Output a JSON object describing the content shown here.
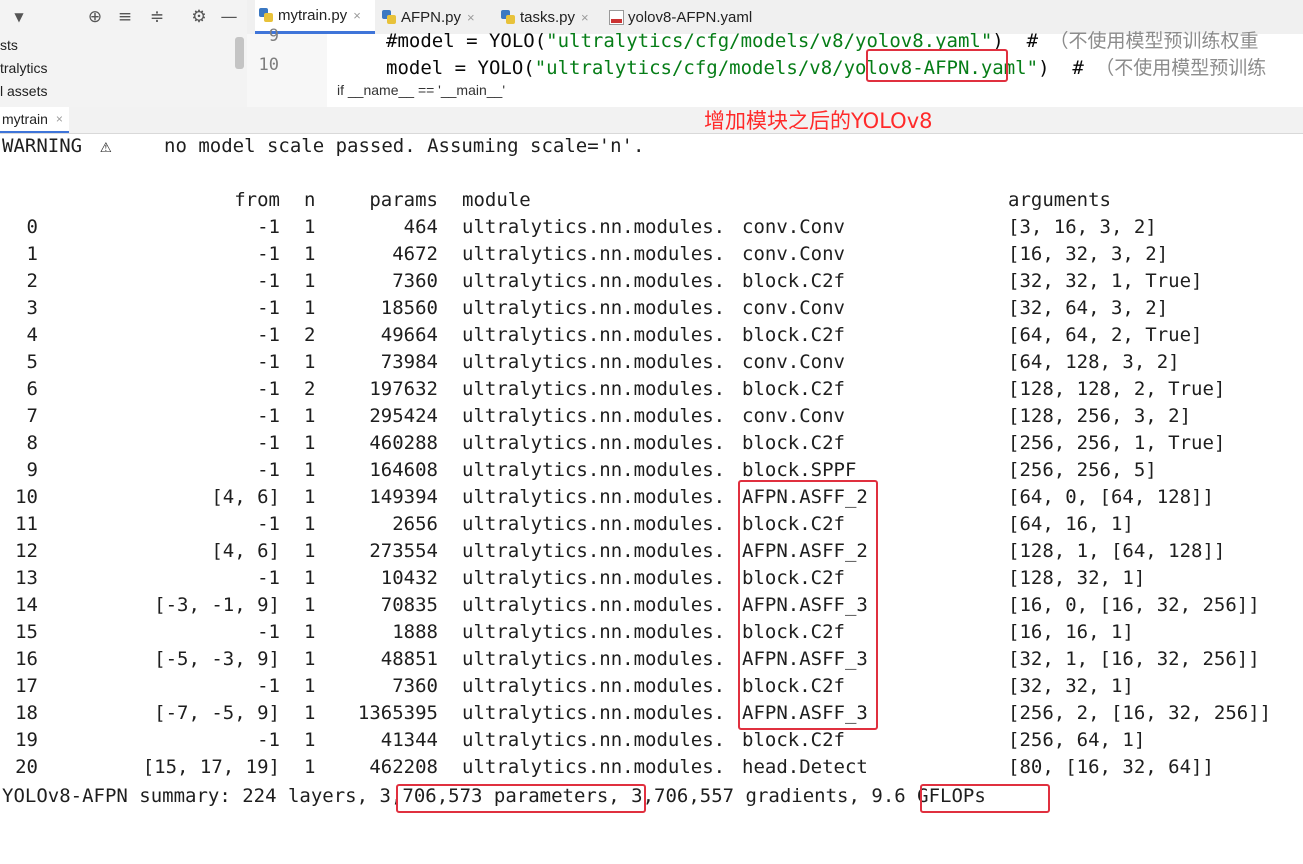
{
  "project_panel": {
    "tree_items": [
      "sts",
      "tralytics",
      "l assets"
    ]
  },
  "editor_tabs": [
    {
      "label": "mytrain.py",
      "icon": "python-file-icon",
      "active": true
    },
    {
      "label": "AFPN.py",
      "icon": "python-file-icon",
      "active": false
    },
    {
      "label": "tasks.py",
      "icon": "python-file-icon",
      "active": false
    },
    {
      "label": "yolov8-AFPN.yaml",
      "icon": "yaml-file-icon",
      "active": false
    }
  ],
  "editor": {
    "lines": [
      {
        "number": "9",
        "code_prefix": "#model = YOLO(",
        "code_string": "\"ultralytics/cfg/models/v8/yolov8.yaml\"",
        "code_rest": ")  # ",
        "comment": "（不使用模型预训练权重"
      },
      {
        "number": "10",
        "code_prefix": "model = YOLO(",
        "code_string_a": "\"ultralytics/cfg/models/v8/",
        "code_string_b": "yolov8-AFPN",
        "code_string_c": ".yaml\"",
        "code_rest": ")  # ",
        "comment": "（不使用模型预训练"
      }
    ],
    "breadcrumb": "if __name__ == '__main__'"
  },
  "run_tab": {
    "label": "mytrain"
  },
  "annotation_text": "增加模块之后的YOLOv8",
  "console": {
    "warning_prefix": "WARNING",
    "warning_icon": "⚠",
    "warning_text": "no model scale passed. Assuming scale='n'.",
    "headers": {
      "from": "from",
      "n": "n",
      "params": "params",
      "module": "module",
      "arguments": "arguments"
    },
    "rows": [
      {
        "idx": "0",
        "from": "-1",
        "n": "1",
        "params": "464",
        "module_prefix": "ultralytics.nn.modules.",
        "module_suffix": "conv.Conv",
        "args": "[3, 16, 3, 2]"
      },
      {
        "idx": "1",
        "from": "-1",
        "n": "1",
        "params": "4672",
        "module_prefix": "ultralytics.nn.modules.",
        "module_suffix": "conv.Conv",
        "args": "[16, 32, 3, 2]"
      },
      {
        "idx": "2",
        "from": "-1",
        "n": "1",
        "params": "7360",
        "module_prefix": "ultralytics.nn.modules.",
        "module_suffix": "block.C2f",
        "args": "[32, 32, 1, True]"
      },
      {
        "idx": "3",
        "from": "-1",
        "n": "1",
        "params": "18560",
        "module_prefix": "ultralytics.nn.modules.",
        "module_suffix": "conv.Conv",
        "args": "[32, 64, 3, 2]"
      },
      {
        "idx": "4",
        "from": "-1",
        "n": "2",
        "params": "49664",
        "module_prefix": "ultralytics.nn.modules.",
        "module_suffix": "block.C2f",
        "args": "[64, 64, 2, True]"
      },
      {
        "idx": "5",
        "from": "-1",
        "n": "1",
        "params": "73984",
        "module_prefix": "ultralytics.nn.modules.",
        "module_suffix": "conv.Conv",
        "args": "[64, 128, 3, 2]"
      },
      {
        "idx": "6",
        "from": "-1",
        "n": "2",
        "params": "197632",
        "module_prefix": "ultralytics.nn.modules.",
        "module_suffix": "block.C2f",
        "args": "[128, 128, 2, True]"
      },
      {
        "idx": "7",
        "from": "-1",
        "n": "1",
        "params": "295424",
        "module_prefix": "ultralytics.nn.modules.",
        "module_suffix": "conv.Conv",
        "args": "[128, 256, 3, 2]"
      },
      {
        "idx": "8",
        "from": "-1",
        "n": "1",
        "params": "460288",
        "module_prefix": "ultralytics.nn.modules.",
        "module_suffix": "block.C2f",
        "args": "[256, 256, 1, True]"
      },
      {
        "idx": "9",
        "from": "-1",
        "n": "1",
        "params": "164608",
        "module_prefix": "ultralytics.nn.modules.",
        "module_suffix": "block.SPPF",
        "args": "[256, 256, 5]"
      },
      {
        "idx": "10",
        "from": "[4, 6]",
        "n": "1",
        "params": "149394",
        "module_prefix": "ultralytics.nn.modules.",
        "module_suffix": "AFPN.ASFF_2",
        "args": "[64, 0, [64, 128]]"
      },
      {
        "idx": "11",
        "from": "-1",
        "n": "1",
        "params": "2656",
        "module_prefix": "ultralytics.nn.modules.",
        "module_suffix": "block.C2f",
        "args": "[64, 16, 1]"
      },
      {
        "idx": "12",
        "from": "[4, 6]",
        "n": "1",
        "params": "273554",
        "module_prefix": "ultralytics.nn.modules.",
        "module_suffix": "AFPN.ASFF_2",
        "args": "[128, 1, [64, 128]]"
      },
      {
        "idx": "13",
        "from": "-1",
        "n": "1",
        "params": "10432",
        "module_prefix": "ultralytics.nn.modules.",
        "module_suffix": "block.C2f",
        "args": "[128, 32, 1]"
      },
      {
        "idx": "14",
        "from": "[-3, -1, 9]",
        "n": "1",
        "params": "70835",
        "module_prefix": "ultralytics.nn.modules.",
        "module_suffix": "AFPN.ASFF_3",
        "args": "[16, 0, [16, 32, 256]]"
      },
      {
        "idx": "15",
        "from": "-1",
        "n": "1",
        "params": "1888",
        "module_prefix": "ultralytics.nn.modules.",
        "module_suffix": "block.C2f",
        "args": "[16, 16, 1]"
      },
      {
        "idx": "16",
        "from": "[-5, -3, 9]",
        "n": "1",
        "params": "48851",
        "module_prefix": "ultralytics.nn.modules.",
        "module_suffix": "AFPN.ASFF_3",
        "args": "[32, 1, [16, 32, 256]]"
      },
      {
        "idx": "17",
        "from": "-1",
        "n": "1",
        "params": "7360",
        "module_prefix": "ultralytics.nn.modules.",
        "module_suffix": "block.C2f",
        "args": "[32, 32, 1]"
      },
      {
        "idx": "18",
        "from": "[-7, -5, 9]",
        "n": "1",
        "params": "1365395",
        "module_prefix": "ultralytics.nn.modules.",
        "module_suffix": "AFPN.ASFF_3",
        "args": "[256, 2, [16, 32, 256]]"
      },
      {
        "idx": "19",
        "from": "-1",
        "n": "1",
        "params": "41344",
        "module_prefix": "ultralytics.nn.modules.",
        "module_suffix": "block.C2f",
        "args": "[256, 64, 1]"
      },
      {
        "idx": "20",
        "from": "[15, 17, 19]",
        "n": "1",
        "params": "462208",
        "module_prefix": "ultralytics.nn.modules.",
        "module_suffix": "head.Detect",
        "args": "[80, [16, 32, 64]]"
      }
    ],
    "summary": {
      "prefix": "YOLOv8-AFPN summary: 224 layers, ",
      "parameters": "3,706,573 parameters",
      "middle": ", 3,706,557 gradients, ",
      "gflops": "9.6 GFLOPs"
    }
  },
  "colors": {
    "highlight_box": "#e0303f",
    "annotation": "#ff2a2a",
    "string": "#067d17",
    "active_tab": "#3f75d9"
  }
}
